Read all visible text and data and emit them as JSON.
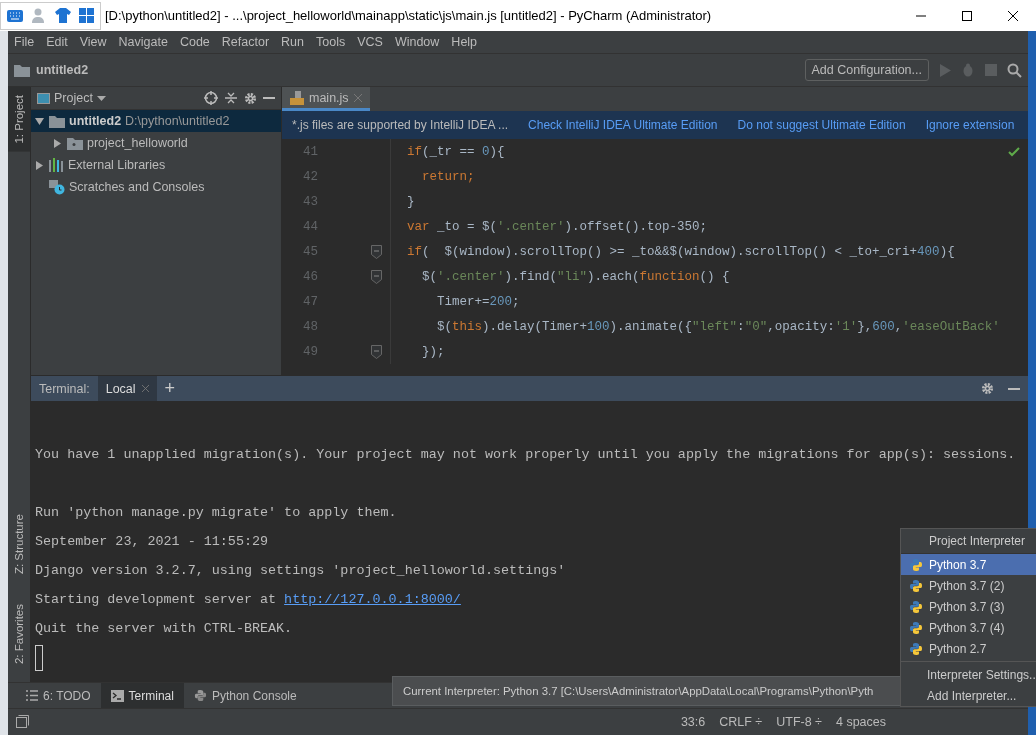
{
  "window": {
    "title": "[D:\\python\\untitled2] - ...\\project_helloworld\\mainapp\\static\\js\\main.js [untitled2] - PyCharm (Administrator)"
  },
  "menu": [
    "File",
    "Edit",
    "View",
    "Navigate",
    "Code",
    "Refactor",
    "Run",
    "Tools",
    "VCS",
    "Window",
    "Help"
  ],
  "navbar": {
    "breadcrumb": "untitled2",
    "run_config": "Add Configuration..."
  },
  "side_stripe": [
    {
      "label": "1: Project",
      "selected": true
    },
    {
      "label": "Z: Structure",
      "selected": false
    },
    {
      "label": "2: Favorites",
      "selected": false
    }
  ],
  "project_panel": {
    "title": "Project",
    "tree": [
      {
        "kind": "folder",
        "name": "untitled2",
        "path": "D:\\python\\untitled2",
        "expanded": true,
        "selected": true,
        "children": [
          {
            "kind": "module",
            "name": "project_helloworld",
            "expanded": false,
            "selected": false
          }
        ]
      },
      {
        "kind": "libraries",
        "name": "External Libraries",
        "expanded": false,
        "selected": false
      },
      {
        "kind": "scratches",
        "name": "Scratches and Consoles",
        "selected": false
      }
    ]
  },
  "editor": {
    "tabs": [
      {
        "label": "main.js",
        "selected": true
      }
    ],
    "banner": {
      "message": "*.js files are supported by IntelliJ IDEA ...",
      "links": [
        "Check IntelliJ IDEA Ultimate Edition",
        "Do not suggest Ultimate Edition",
        "Ignore extension"
      ]
    },
    "lines": [
      {
        "number": "41",
        "fold": false,
        "segments": [
          {
            "kind": "keyword",
            "text": "if"
          },
          {
            "kind": "plain",
            "text": "(_tr == "
          },
          {
            "kind": "number",
            "text": "0"
          },
          {
            "kind": "plain",
            "text": "){"
          }
        ]
      },
      {
        "number": "42",
        "fold": false,
        "segments": [
          {
            "kind": "keyword",
            "text": "  return;"
          }
        ]
      },
      {
        "number": "43",
        "fold": false,
        "segments": [
          {
            "kind": "plain",
            "text": "}"
          }
        ]
      },
      {
        "number": "44",
        "fold": false,
        "segments": [
          {
            "kind": "keyword",
            "text": "var "
          },
          {
            "kind": "plain",
            "text": "_to = $("
          },
          {
            "kind": "string",
            "text": "'.center'"
          },
          {
            "kind": "plain",
            "text": ").offset().top-350;"
          }
        ]
      },
      {
        "number": "45",
        "fold": true,
        "segments": [
          {
            "kind": "keyword",
            "text": "if"
          },
          {
            "kind": "plain",
            "text": "(  $(window).scrollTop() >= _to&&$(window).scrollTop() < _to+_cri+"
          },
          {
            "kind": "number",
            "text": "400"
          },
          {
            "kind": "plain",
            "text": "){"
          }
        ]
      },
      {
        "number": "46",
        "fold": true,
        "segments": [
          {
            "kind": "plain",
            "text": "  $("
          },
          {
            "kind": "string",
            "text": "'.center'"
          },
          {
            "kind": "plain",
            "text": ").find("
          },
          {
            "kind": "string",
            "text": "\"li\""
          },
          {
            "kind": "plain",
            "text": ").each("
          },
          {
            "kind": "keyword",
            "text": "function"
          },
          {
            "kind": "plain",
            "text": "() {"
          }
        ]
      },
      {
        "number": "47",
        "fold": false,
        "segments": [
          {
            "kind": "plain",
            "text": "    Timer+="
          },
          {
            "kind": "number",
            "text": "200"
          },
          {
            "kind": "plain",
            "text": ";"
          }
        ]
      },
      {
        "number": "48",
        "fold": false,
        "segments": [
          {
            "kind": "plain",
            "text": "    $("
          },
          {
            "kind": "keyword",
            "text": "this"
          },
          {
            "kind": "plain",
            "text": ").delay(Timer+"
          },
          {
            "kind": "number",
            "text": "100"
          },
          {
            "kind": "plain",
            "text": ").animate({"
          },
          {
            "kind": "string",
            "text": "\"left\""
          },
          {
            "kind": "plain",
            "text": ":"
          },
          {
            "kind": "string",
            "text": "\"0\""
          },
          {
            "kind": "plain",
            "text": ",opacity:"
          },
          {
            "kind": "string",
            "text": "'1'"
          },
          {
            "kind": "plain",
            "text": "},"
          },
          {
            "kind": "number",
            "text": "600"
          },
          {
            "kind": "plain",
            "text": ","
          },
          {
            "kind": "string",
            "text": "'easeOutBack'"
          }
        ]
      },
      {
        "number": "49",
        "fold": true,
        "segments": [
          {
            "kind": "plain",
            "text": "  });"
          }
        ]
      }
    ]
  },
  "terminal": {
    "label": "Terminal:",
    "tabs": [
      {
        "label": "Local",
        "selected": true
      }
    ],
    "add": "+",
    "lines": [
      {
        "kind": "blank"
      },
      {
        "kind": "text",
        "text": "You have 1 unapplied migration(s). Your project may not work properly until you apply the migrations for app(s): sessions."
      },
      {
        "kind": "blank"
      },
      {
        "kind": "text",
        "text": "Run 'python manage.py migrate' to apply them."
      },
      {
        "kind": "text",
        "text": "September 23, 2021 - 11:55:29"
      },
      {
        "kind": "text",
        "text": "Django version 3.2.7, using settings 'project_helloworld.settings'"
      },
      {
        "kind": "link",
        "text": "Starting development server at ",
        "link": "http://127.0.0.1:8000/"
      },
      {
        "kind": "text",
        "text": "Quit the server with CTRL-BREAK."
      },
      {
        "kind": "cursor"
      }
    ]
  },
  "tool_tabs": [
    {
      "kind": "todo",
      "label": "6: TODO",
      "selected": false
    },
    {
      "kind": "terminal",
      "label": "Terminal",
      "selected": true
    },
    {
      "kind": "python",
      "label": "Python Console",
      "selected": false
    }
  ],
  "tooltip": "Current Interpreter: Python 3.7 [C:\\Users\\Administrator\\AppData\\Local\\Programs\\Python\\Pyth",
  "interpreter_popup": {
    "title": "Project Interpreter",
    "items": [
      {
        "label": "Python 3.7",
        "selected": true
      },
      {
        "label": "Python 3.7 (2)",
        "selected": false
      },
      {
        "label": "Python 3.7 (3)",
        "selected": false
      },
      {
        "label": "Python 3.7 (4)",
        "selected": false
      },
      {
        "label": "Python 2.7",
        "selected": false
      }
    ],
    "actions": [
      "Interpreter Settings..",
      "Add Interpreter..."
    ]
  },
  "status_bar": [
    "33:6",
    "CRLF ÷",
    "UTF-8 ÷",
    "4 spaces"
  ]
}
